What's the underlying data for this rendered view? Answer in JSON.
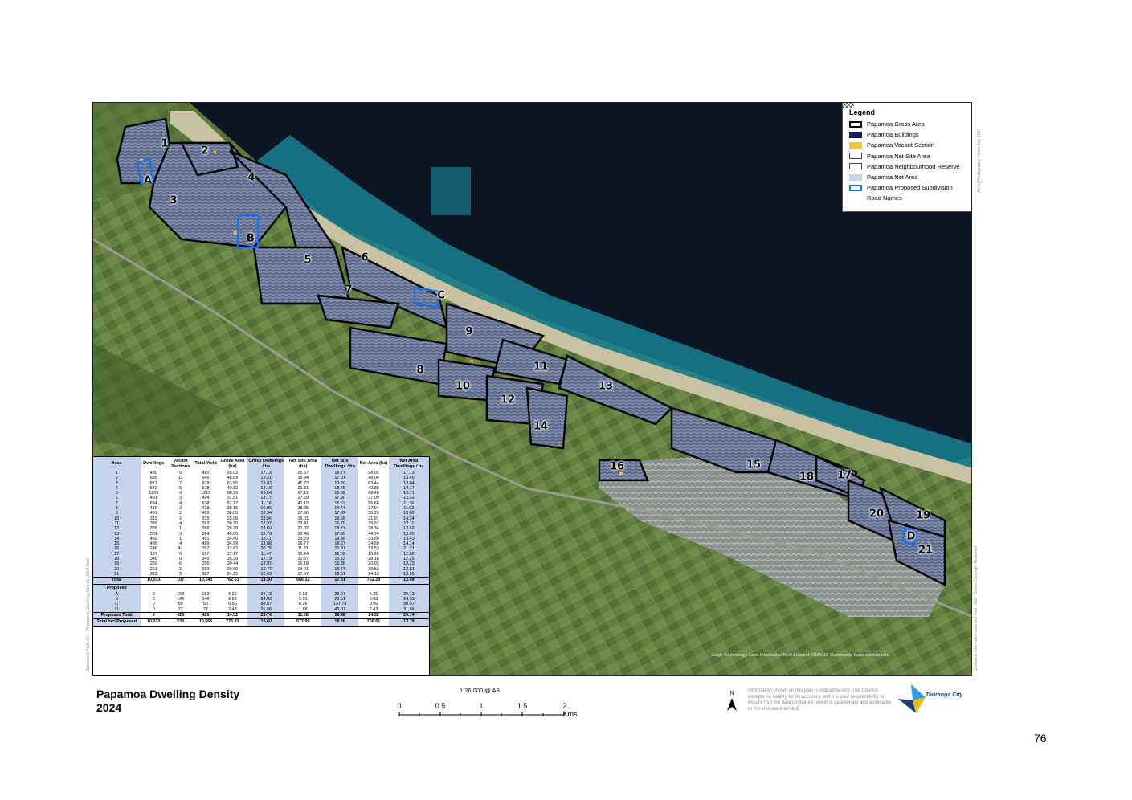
{
  "title": {
    "line1": "Papamoa Dwelling Density",
    "line2": "2024"
  },
  "legend": {
    "title": "Legend",
    "items": [
      {
        "label": "Papamoa Gross Area",
        "swatch": "gross"
      },
      {
        "label": "Papamoa Buildings",
        "swatch": "buildings"
      },
      {
        "label": "Papamoa Vacant Section",
        "swatch": "vacant"
      },
      {
        "label": "Papamoa Net Site Area",
        "swatch": "netsite"
      },
      {
        "label": "Papamoa Neighbourhood Reserve",
        "swatch": "reserve"
      },
      {
        "label": "Papamoa Net Area",
        "swatch": "netarea"
      },
      {
        "label": "Papamoa Proposed Subdivision",
        "swatch": "proposed"
      },
      {
        "label": "Road Names",
        "swatch": "none"
      }
    ]
  },
  "map_labels": [
    "1",
    "2",
    "3",
    "4",
    "A",
    "B",
    "5",
    "6",
    "7",
    "C",
    "9",
    "8",
    "10",
    "11",
    "12",
    "13",
    "14",
    "16",
    "15",
    "18",
    "17",
    "20",
    "19",
    "D",
    "21"
  ],
  "map_credits": {
    "attribution": "Eagle Technology, Land Information New Zealand, GEBCO, Community maps contributors",
    "aerial": "Aerial Photography Flown July 2024",
    "cadastral": "Cadastral Information sourced from LINZ · Crown Copyright Reserved",
    "doc_path": "Document Path: O:\\\\...\\\\Papamoa_Dwelling_Density_2024.mxd"
  },
  "table": {
    "headers": [
      "Area",
      "Dwellings",
      "Vacant Sections",
      "Total Yield",
      "Gross Area (ha)",
      "Gross Dwellings / ha",
      "Net Site Area (ha)",
      "Net Site Dwellings / ha",
      "Net Area (ha)",
      "Net Area Dwellings / ha"
    ],
    "rows": [
      [
        "1",
        "480",
        "0",
        "480",
        "28.03",
        "17.13",
        "25.57",
        "18.77",
        "28.03",
        "17.13"
      ],
      [
        "2",
        "635",
        "11",
        "646",
        "48.89",
        "13.21",
        "35.94",
        "17.97",
        "48.04",
        "13.45"
      ],
      [
        "3",
        "871",
        "7",
        "878",
        "63.55",
        "13.82",
        "45.72",
        "19.20",
        "63.44",
        "13.84"
      ],
      [
        "4",
        "573",
        "5",
        "578",
        "40.82",
        "14.16",
        "31.31",
        "18.46",
        "40.80",
        "14.17"
      ],
      [
        "5",
        "1209",
        "4",
        "1213",
        "88.95",
        "13.64",
        "67.11",
        "18.08",
        "88.49",
        "13.71"
      ],
      [
        "6",
        "491",
        "3",
        "494",
        "37.51",
        "13.17",
        "27.59",
        "17.90",
        "37.09",
        "13.32"
      ],
      [
        "7",
        "634",
        "4",
        "638",
        "57.17",
        "11.16",
        "41.10",
        "15.52",
        "56.68",
        "11.26"
      ],
      [
        "8",
        "416",
        "2",
        "418",
        "38.16",
        "10.96",
        "28.95",
        "14.44",
        "37.94",
        "11.02"
      ],
      [
        "9",
        "491",
        "2",
        "493",
        "38.09",
        "12.94",
        "27.86",
        "17.69",
        "36.20",
        "13.62"
      ],
      [
        "10",
        "313",
        "2",
        "315",
        "23.06",
        "13.66",
        "16.01",
        "19.68",
        "21.97",
        "14.34"
      ],
      [
        "11",
        "389",
        "4",
        "393",
        "30.30",
        "12.97",
        "23.41",
        "16.79",
        "29.97",
        "13.11"
      ],
      [
        "12",
        "385",
        "1",
        "386",
        "28.38",
        "13.60",
        "21.02",
        "18.37",
        "28.34",
        "13.62"
      ],
      [
        "13",
        "581",
        "3",
        "584",
        "45.65",
        "12.79",
        "32.46",
        "17.99",
        "44.74",
        "13.05"
      ],
      [
        "14",
        "450",
        "1",
        "451",
        "34.40",
        "13.11",
        "23.29",
        "19.36",
        "33.59",
        "13.43"
      ],
      [
        "15",
        "485",
        "4",
        "489",
        "34.99",
        "13.98",
        "26.77",
        "18.27",
        "34.59",
        "14.14"
      ],
      [
        "16",
        "246",
        "41",
        "287",
        "13.83",
        "20.75",
        "11.31",
        "25.37",
        "13.53",
        "21.21"
      ],
      [
        "17",
        "197",
        "0",
        "197",
        "17.17",
        "11.47",
        "12.24",
        "16.09",
        "15.99",
        "12.32"
      ],
      [
        "18",
        "345",
        "0",
        "345",
        "28.30",
        "12.19",
        "20.87",
        "16.53",
        "28.16",
        "12.25"
      ],
      [
        "19",
        "259",
        "6",
        "265",
        "20.44",
        "12.97",
        "16.18",
        "16.38",
        "20.03",
        "13.23"
      ],
      [
        "20",
        "261",
        "2",
        "263",
        "20.60",
        "12.77",
        "14.01",
        "18.77",
        "20.53",
        "12.81"
      ],
      [
        "21",
        "322",
        "5",
        "327",
        "24.25",
        "13.49",
        "17.57",
        "18.61",
        "24.13",
        "13.55"
      ]
    ],
    "total": [
      "Total",
      "10,033",
      "107",
      "10,140",
      "762.51",
      "13.30",
      "566.32",
      "17.91",
      "752.29",
      "13.48"
    ],
    "proposed_header": "Proposed",
    "proposed_rows": [
      [
        "A",
        "0",
        "153",
        "153",
        "5.25",
        "29.13",
        "3.93",
        "38.97",
        "5.25",
        "29.13"
      ],
      [
        "B",
        "0",
        "146",
        "146",
        "6.08",
        "24.03",
        "5.51",
        "26.51",
        "6.08",
        "24.03"
      ],
      [
        "C",
        "0",
        "50",
        "50",
        "0.56",
        "88.97",
        "0.36",
        "137.78",
        "0.56",
        "88.97"
      ],
      [
        "D",
        "0",
        "77",
        "77",
        "2.43",
        "31.66",
        "1.88",
        "40.97",
        "2.43",
        "31.66"
      ]
    ],
    "proposed_total": [
      "Proposed Total",
      "0",
      "426",
      "426",
      "14.32",
      "29.74",
      "11.68",
      "36.48",
      "14.32",
      "29.74"
    ],
    "grand_total": [
      "Total Incl Proposed",
      "10,033",
      "533",
      "10,566",
      "776.83",
      "13.60",
      "577.99",
      "18.28",
      "766.61",
      "13.78"
    ]
  },
  "scale": {
    "caption": "1:26,000 @ A3",
    "ticks": [
      "0",
      "0.5",
      "1",
      "1.5",
      "2 Kms"
    ]
  },
  "north": "N",
  "disclaimer": "Information shown on this plan is indicative only. The Council accepts no liability for its accuracy and it is your responsibility to ensure that the data contained herein is appropriate and applicable to the end use intended.",
  "logo": {
    "text": "Tauranga City"
  },
  "page_number": "76",
  "colors": {
    "ocean": "#0b1524",
    "coast": "#1d8a9e",
    "sand": "#c8c2a2",
    "farmland": "#5f7d3e",
    "urban": "#6f7c9e",
    "boundary": "#000000",
    "net_area_fill": "#c5d3ec",
    "vacant": "#f5bf42",
    "proposed": "#1a73e8"
  }
}
